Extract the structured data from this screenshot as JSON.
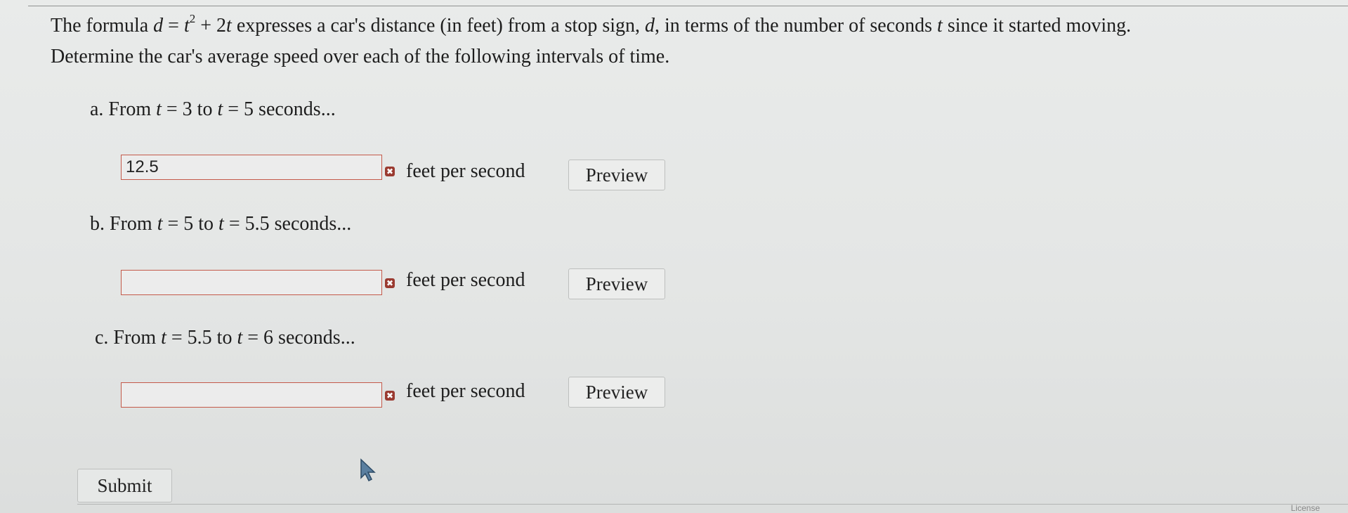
{
  "question": {
    "intro": "The formula",
    "var_d": "d",
    "eq": " = ",
    "var_t": "t",
    "exp": "2",
    "plus": " + 2",
    "var_t2": "t",
    "rest1": " expresses a car's distance (in feet) from a stop sign, ",
    "var_d2": "d",
    "rest2": ", in terms of the number of seconds ",
    "var_t3": "t",
    "rest3": " since it started moving.",
    "line2": "Determine the car's average speed over each of the following intervals of time."
  },
  "parts": [
    {
      "prefix": "a. From ",
      "t": "t",
      "eq1": " = 3 to ",
      "t2": "t",
      "eq2": " = 5 seconds...",
      "answer": "12.5",
      "unit": "feet per second",
      "preview": "Preview"
    },
    {
      "prefix": "b. From ",
      "t": "t",
      "eq1": " = 5 to ",
      "t2": "t",
      "eq2": " = 5.5 seconds...",
      "answer": "",
      "unit": "feet per second",
      "preview": "Preview"
    },
    {
      "prefix": "c. From ",
      "t": "t",
      "eq1": " = 5.5 to ",
      "t2": "t",
      "eq2": " = 6 seconds...",
      "answer": "",
      "unit": "feet per second",
      "preview": "Preview"
    }
  ],
  "wrong_mark": "✖",
  "submit_label": "Submit",
  "license": "License",
  "colors": {
    "error_border": "#c45a4a",
    "background": "#e6e8e7"
  }
}
